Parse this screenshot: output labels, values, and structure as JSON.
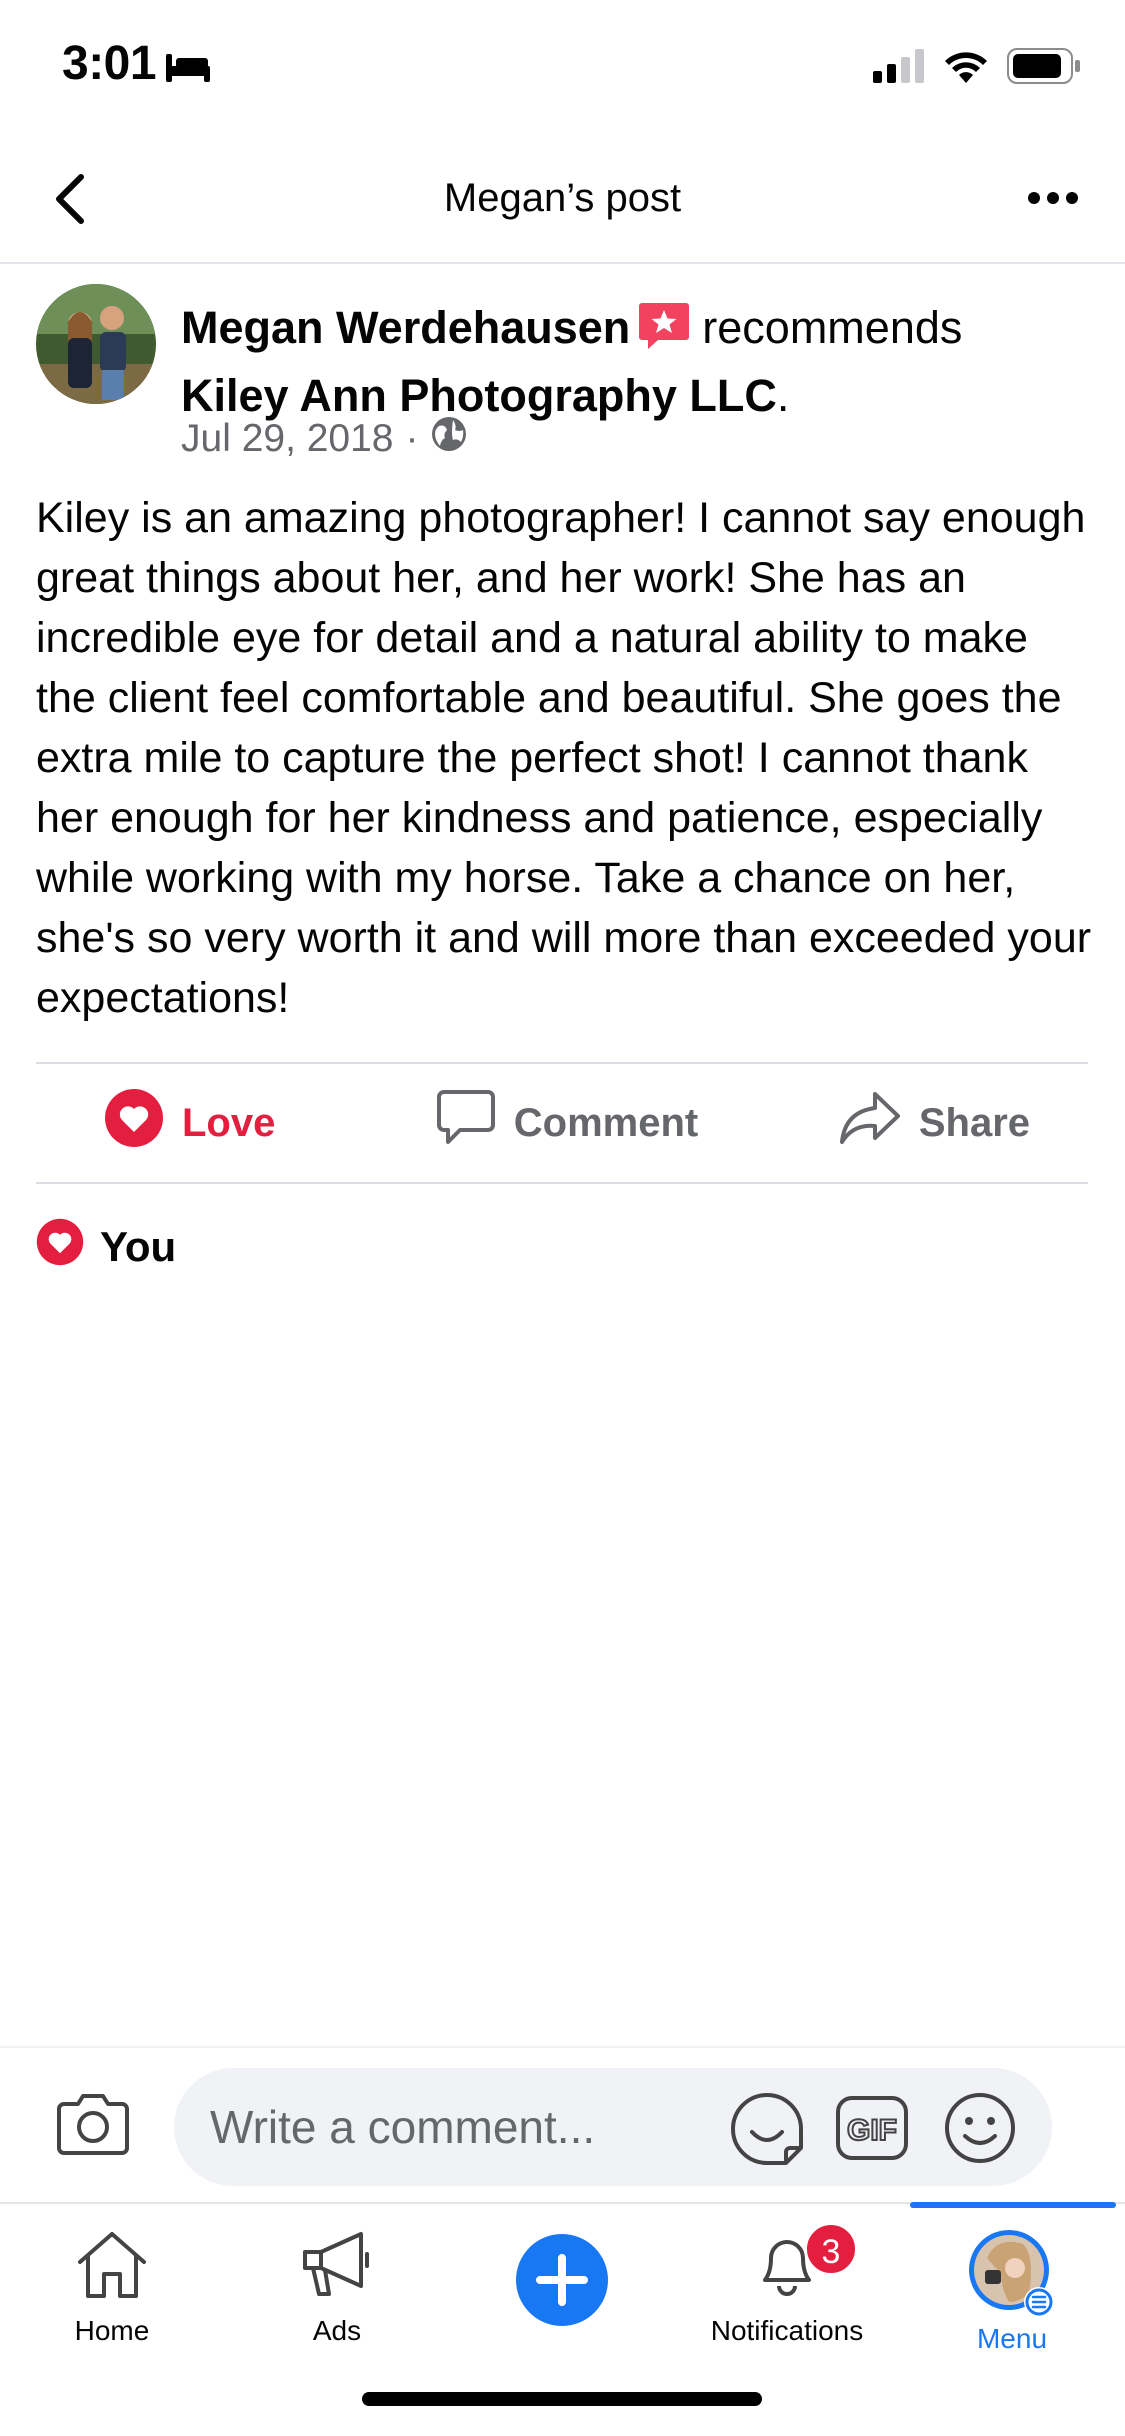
{
  "status_bar": {
    "time": "3:01",
    "icons": [
      "bed-icon",
      "cellular-signal-icon",
      "wifi-icon",
      "battery-icon"
    ]
  },
  "header": {
    "title": "Megan’s post",
    "back_icon": "chevron-left-icon",
    "more_icon": "more-horizontal-icon"
  },
  "post": {
    "author": "Megan Werdehausen",
    "badge_icon": "recommendation-star-icon",
    "verb": "recommends",
    "page_name": "Kiley Ann Photography LLC",
    "page_name_suffix": ".",
    "date": "Jul 29, 2018",
    "separator": "·",
    "privacy_icon": "globe-icon",
    "body": "Kiley is an amazing photographer! I cannot say enough great things about her, and her work! She has an incredible eye for detail and a natural ability to make the client feel comfortable and beautiful. She goes the extra mile to capture the perfect shot! I cannot thank her enough for her kindness and patience, especially while working with my horse. Take a chance on her, she's so very worth it and will more than exceeded your expectations!"
  },
  "actions": {
    "love_label": "Love",
    "comment_label": "Comment",
    "share_label": "Share"
  },
  "reactions": {
    "icon": "heart-reaction-icon",
    "text": "You"
  },
  "composer": {
    "placeholder": "Write a comment...",
    "icons": [
      "camera-icon",
      "sticker-icon",
      "gif-icon",
      "emoji-icon"
    ],
    "gif_text": "GIF"
  },
  "tabbar": {
    "tabs": [
      {
        "label": "Home",
        "icon": "home-icon"
      },
      {
        "label": "Ads",
        "icon": "megaphone-icon"
      },
      {
        "label": "",
        "icon": "plus-icon"
      },
      {
        "label": "Notifications",
        "icon": "bell-icon",
        "badge": "3"
      },
      {
        "label": "Menu",
        "icon": "profile-menu-icon",
        "active": true
      }
    ]
  },
  "colors": {
    "brand_blue": "#1877f2",
    "love_red": "#e41e3f",
    "secondary_text": "#65676b"
  }
}
